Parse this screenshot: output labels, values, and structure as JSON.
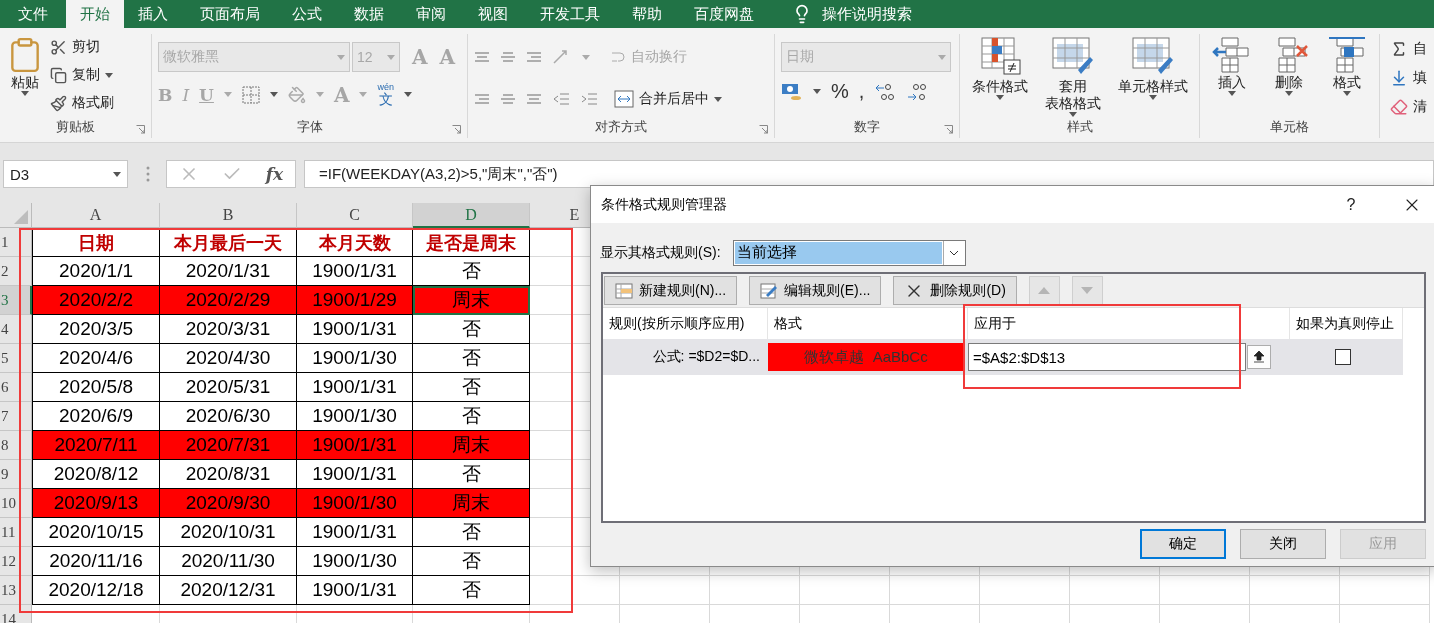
{
  "tabs": [
    {
      "label": "文件",
      "selected": false
    },
    {
      "label": "开始",
      "selected": true
    },
    {
      "label": "插入",
      "selected": false
    },
    {
      "label": "页面布局",
      "selected": false
    },
    {
      "label": "公式",
      "selected": false
    },
    {
      "label": "数据",
      "selected": false
    },
    {
      "label": "审阅",
      "selected": false
    },
    {
      "label": "视图",
      "selected": false
    },
    {
      "label": "开发工具",
      "selected": false
    },
    {
      "label": "帮助",
      "selected": false
    },
    {
      "label": "百度网盘",
      "selected": false
    }
  ],
  "search": {
    "label": "操作说明搜索"
  },
  "ribbon": {
    "clipboard": {
      "title": "剪贴板",
      "paste": "粘贴",
      "items": [
        "剪切",
        "复制",
        "格式刷"
      ]
    },
    "font": {
      "title": "字体",
      "font_name": "微软雅黑",
      "font_size": "12",
      "size_buttons": [
        "A",
        "A"
      ],
      "styles": [
        "B",
        "I",
        "U"
      ],
      "color_glyph": "A",
      "phonetic_top": "wén",
      "phonetic": "文"
    },
    "alignment": {
      "title": "对齐方式",
      "wrap": "自动换行",
      "merge": "合并后居中"
    },
    "number": {
      "title": "数字",
      "format": "日期",
      "symbols": [
        "%",
        ","
      ]
    },
    "styles": {
      "title": "样式",
      "buttons": [
        [
          "条件格式"
        ],
        [
          "套用",
          "表格格式"
        ],
        [
          "单元格样式"
        ]
      ]
    },
    "cells": {
      "title": "单元格",
      "buttons": [
        "插入",
        "删除",
        "格式"
      ]
    },
    "editing": {
      "items": [
        "自",
        "填",
        "清"
      ]
    }
  },
  "name_box": "D3",
  "fx_label": "fx",
  "formula": "=IF(WEEKDAY(A3,2)>5,\"周末\",\"否\")",
  "columns": [
    {
      "label": "A",
      "selected": false
    },
    {
      "label": "B",
      "selected": false
    },
    {
      "label": "C",
      "selected": false
    },
    {
      "label": "D",
      "selected": true
    },
    {
      "label": "E",
      "selected": false
    }
  ],
  "rows": [
    {
      "number": "1",
      "kind": "title",
      "selected": false,
      "cells": [
        "日期",
        "本月最后一天",
        "本月天数",
        "是否是周末"
      ]
    },
    {
      "number": "2",
      "kind": "data",
      "selected": false,
      "highlighted": false,
      "cells": [
        "2020/1/1",
        "2020/1/31",
        "1900/1/31",
        "否"
      ]
    },
    {
      "number": "3",
      "kind": "data",
      "selected": true,
      "highlighted": true,
      "cells": [
        "2020/2/2",
        "2020/2/29",
        "1900/1/29",
        "周末"
      ]
    },
    {
      "number": "4",
      "kind": "data",
      "selected": false,
      "highlighted": false,
      "cells": [
        "2020/3/5",
        "2020/3/31",
        "1900/1/31",
        "否"
      ]
    },
    {
      "number": "5",
      "kind": "data",
      "selected": false,
      "highlighted": false,
      "cells": [
        "2020/4/6",
        "2020/4/30",
        "1900/1/30",
        "否"
      ]
    },
    {
      "number": "6",
      "kind": "data",
      "selected": false,
      "highlighted": false,
      "cells": [
        "2020/5/8",
        "2020/5/31",
        "1900/1/31",
        "否"
      ]
    },
    {
      "number": "7",
      "kind": "data",
      "selected": false,
      "highlighted": false,
      "cells": [
        "2020/6/9",
        "2020/6/30",
        "1900/1/30",
        "否"
      ]
    },
    {
      "number": "8",
      "kind": "data",
      "selected": false,
      "highlighted": true,
      "cells": [
        "2020/7/11",
        "2020/7/31",
        "1900/1/31",
        "周末"
      ]
    },
    {
      "number": "9",
      "kind": "data",
      "selected": false,
      "highlighted": false,
      "cells": [
        "2020/8/12",
        "2020/8/31",
        "1900/1/31",
        "否"
      ]
    },
    {
      "number": "10",
      "kind": "data",
      "selected": false,
      "highlighted": true,
      "cells": [
        "2020/9/13",
        "2020/9/30",
        "1900/1/30",
        "周末"
      ]
    },
    {
      "number": "11",
      "kind": "data",
      "selected": false,
      "highlighted": false,
      "cells": [
        "2020/10/15",
        "2020/10/31",
        "1900/1/31",
        "否"
      ]
    },
    {
      "number": "12",
      "kind": "data",
      "selected": false,
      "highlighted": false,
      "cells": [
        "2020/11/16",
        "2020/11/30",
        "1900/1/30",
        "否"
      ]
    },
    {
      "number": "13",
      "kind": "data",
      "selected": false,
      "highlighted": false,
      "cells": [
        "2020/12/18",
        "2020/12/31",
        "1900/1/31",
        "否"
      ]
    },
    {
      "number": "14",
      "kind": "empty",
      "selected": false
    }
  ],
  "dialog": {
    "title": "条件格式规则管理器",
    "help": "?",
    "show_label": "显示其格式规则(S):",
    "show_value": "当前选择",
    "toolbar": [
      {
        "label": "新建规则(N)...",
        "kind": "new"
      },
      {
        "label": "编辑规则(E)...",
        "kind": "edit"
      },
      {
        "label": "删除规则(D)",
        "kind": "delete"
      }
    ],
    "move_buttons": [
      {
        "kind": "up",
        "disabled": true
      },
      {
        "kind": "down",
        "disabled": true
      }
    ],
    "headers": [
      "规则(按所示顺序应用)",
      "格式",
      "应用于",
      "如果为真则停止"
    ],
    "rules": [
      {
        "rule": "公式: =$D2=$D...",
        "preview": "微软卓越  AaBbCc",
        "applies_to": "=$A$2:$D$13",
        "stop_if_true": false
      }
    ],
    "buttons": [
      {
        "label": "确定",
        "primary": true,
        "disabled": false
      },
      {
        "label": "关闭",
        "primary": false,
        "disabled": false
      },
      {
        "label": "应用",
        "primary": false,
        "disabled": true
      }
    ]
  }
}
